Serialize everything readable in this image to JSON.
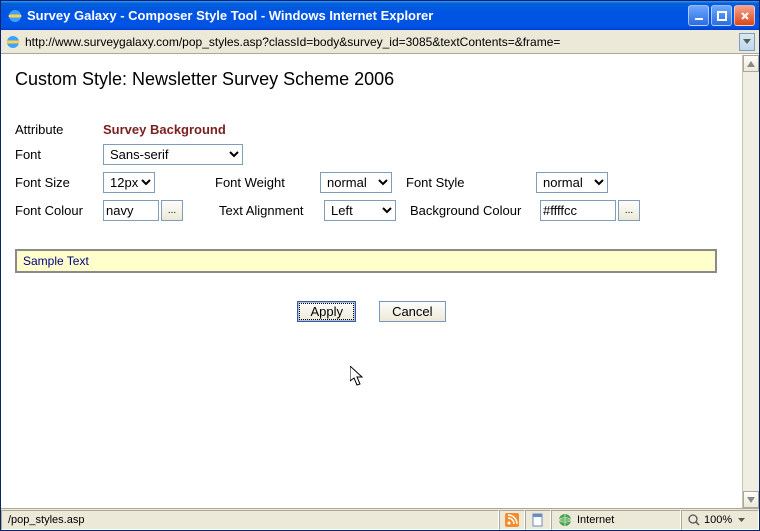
{
  "window": {
    "title": "Survey Galaxy - Composer Style Tool - Windows Internet Explorer",
    "url": "http://www.surveygalaxy.com/pop_styles.asp?classId=body&survey_id=3085&textContents=&frame="
  },
  "page": {
    "heading": "Custom Style: Newsletter Survey Scheme 2006"
  },
  "labels": {
    "attribute": "Attribute",
    "font": "Font",
    "font_size": "Font Size",
    "font_weight": "Font Weight",
    "font_style": "Font Style",
    "font_colour": "Font Colour",
    "text_alignment": "Text Alignment",
    "background_colour": "Background Colour"
  },
  "values": {
    "attribute": "Survey Background",
    "font": "Sans-serif",
    "font_size": "12px",
    "font_weight": "normal",
    "font_style": "normal",
    "font_colour": "navy",
    "text_alignment": "Left",
    "background_colour": "#ffffcc"
  },
  "sample": {
    "text": "Sample Text"
  },
  "buttons": {
    "apply": "Apply",
    "cancel": "Cancel",
    "picker": "..."
  },
  "status": {
    "left": "/pop_styles.asp",
    "zone": "Internet",
    "zoom": "100%"
  }
}
